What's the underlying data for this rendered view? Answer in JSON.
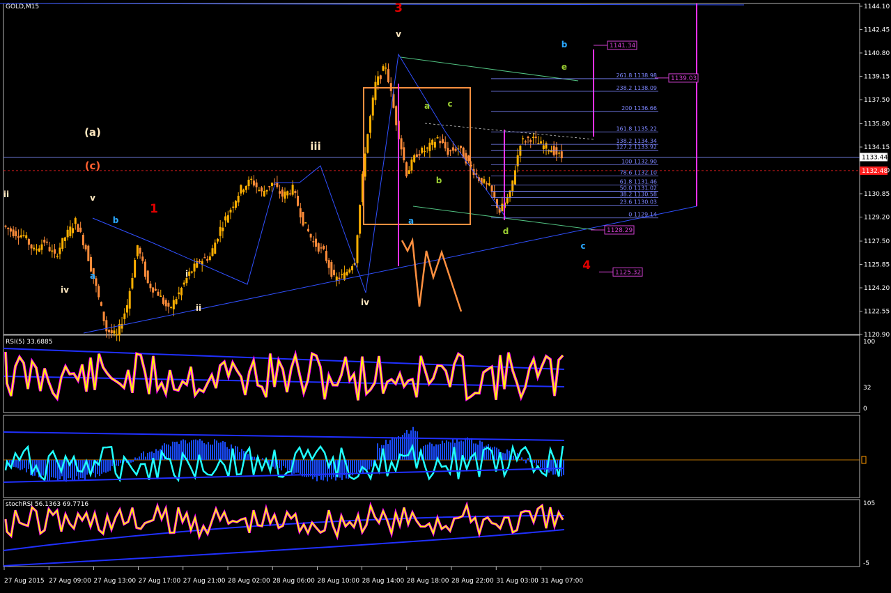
{
  "window": {
    "title": "GOLD,M15",
    "current_price_label": "1133.44",
    "bid_label": "1132.48"
  },
  "colors": {
    "background": "#000000",
    "grid": "#ffffff",
    "bull_candle": "#ffb000",
    "bear_candle": "#ff8c3a",
    "trendline": "#3050ff",
    "fib": "#7d86ff",
    "target_box": "#d040d0",
    "wave_red": "#e00000",
    "wave_cyan": "#2aa8ff",
    "wave_green": "#9acd32",
    "wave_cream": "#ffe8c0",
    "projection": "#ff9040",
    "rsi_line": "#ffff00",
    "rsi_highlight": "#ff00ff"
  },
  "price_axis": {
    "ticks": [
      "1144.10",
      "1142.45",
      "1140.80",
      "1139.15",
      "1137.50",
      "1135.80",
      "1134.15",
      "1132.50",
      "1130.85",
      "1129.20",
      "1127.50",
      "1125.85",
      "1124.20",
      "1122.55",
      "1120.90"
    ]
  },
  "time_axis": {
    "ticks": [
      "27 Aug 2015",
      "27 Aug 09:00",
      "27 Aug 13:00",
      "27 Aug 17:00",
      "27 Aug 21:00",
      "28 Aug 02:00",
      "28 Aug 06:00",
      "28 Aug 10:00",
      "28 Aug 14:00",
      "28 Aug 18:00",
      "28 Aug 22:00",
      "31 Aug 03:00",
      "31 Aug 07:00"
    ]
  },
  "fib_levels": [
    {
      "label": "261.8 1138.98",
      "price": 1138.98
    },
    {
      "label": "238.2 1138.09",
      "price": 1138.09
    },
    {
      "label": "200 1136.66",
      "price": 1136.66
    },
    {
      "label": "161.8 1135.22",
      "price": 1135.22
    },
    {
      "label": "138.2 1134.34",
      "price": 1134.34
    },
    {
      "label": "127.2 1133.92",
      "price": 1133.92
    },
    {
      "label": "100 1132.90",
      "price": 1132.9
    },
    {
      "label": "78.6 1132.10",
      "price": 1132.1
    },
    {
      "label": "61.8 1131.46",
      "price": 1131.46
    },
    {
      "label": "50.0 1131.02",
      "price": 1131.02
    },
    {
      "label": "38.2 1130.58",
      "price": 1130.58
    },
    {
      "label": "23.6 1130.03",
      "price": 1130.03
    },
    {
      "label": "0 1129.14",
      "price": 1129.14
    }
  ],
  "price_targets": [
    {
      "label": "1141.34",
      "price": 1141.34
    },
    {
      "label": "1139.03",
      "price": 1139.03
    },
    {
      "label": "1128.29",
      "price": 1128.29
    },
    {
      "label": "1125.32",
      "price": 1125.32
    }
  ],
  "wave_labels": [
    {
      "text": "3",
      "color": "red",
      "x": 572,
      "y": 12
    },
    {
      "text": "v",
      "color": "cream",
      "x": 572,
      "y": 48
    },
    {
      "text": "b",
      "color": "cyan",
      "x": 810,
      "y": 63
    },
    {
      "text": "e",
      "color": "green",
      "x": 810,
      "y": 95
    },
    {
      "text": "(a)",
      "color": "cream",
      "x": 133,
      "y": 190
    },
    {
      "text": "(c)",
      "color": "orange",
      "x": 133,
      "y": 238
    },
    {
      "text": "iii",
      "color": "cream",
      "x": 453,
      "y": 210
    },
    {
      "text": "ii",
      "color": "cream",
      "x": 9,
      "y": 278
    },
    {
      "text": "v",
      "color": "cream",
      "x": 133,
      "y": 283
    },
    {
      "text": "1",
      "color": "red",
      "x": 221,
      "y": 300
    },
    {
      "text": "b",
      "color": "cyan",
      "x": 166,
      "y": 315
    },
    {
      "text": "a",
      "color": "green",
      "x": 613,
      "y": 151
    },
    {
      "text": "c",
      "color": "green",
      "x": 646,
      "y": 148
    },
    {
      "text": "b",
      "color": "green",
      "x": 630,
      "y": 258
    },
    {
      "text": "a",
      "color": "cyan",
      "x": 590,
      "y": 316
    },
    {
      "text": "d",
      "color": "green",
      "x": 726,
      "y": 331
    },
    {
      "text": "c",
      "color": "cyan",
      "x": 837,
      "y": 352
    },
    {
      "text": "4",
      "color": "red",
      "x": 842,
      "y": 381
    },
    {
      "text": "i",
      "color": "cream",
      "x": 268,
      "y": 392
    },
    {
      "text": "a",
      "color": "cyan",
      "x": 133,
      "y": 395
    },
    {
      "text": "iv",
      "color": "cream",
      "x": 93,
      "y": 415
    },
    {
      "text": "ii",
      "color": "cream",
      "x": 285,
      "y": 441
    },
    {
      "text": "iv",
      "color": "cream",
      "x": 524,
      "y": 433
    }
  ],
  "rsi": {
    "title": "RSI(5) 33.6885",
    "scale": [
      "100",
      "32",
      "0"
    ]
  },
  "macd": {
    "title": ""
  },
  "stoch": {
    "title": "stochRSI 56.1363 69.7716",
    "scale": [
      "105",
      "-5"
    ]
  },
  "chart_data": {
    "type": "candlestick",
    "title": "GOLD,M15",
    "ylim": [
      1120.9,
      1144.1
    ],
    "x": [
      "27 Aug 2015",
      "27 Aug 09:00",
      "27 Aug 13:00",
      "27 Aug 17:00",
      "27 Aug 21:00",
      "28 Aug 02:00",
      "28 Aug 06:00",
      "28 Aug 10:00",
      "28 Aug 14:00",
      "28 Aug 18:00",
      "28 Aug 22:00",
      "31 Aug 03:00",
      "31 Aug 07:00"
    ],
    "close_path": [
      1128.6,
      1128.1,
      1127.9,
      1126.8,
      1127.5,
      1126.4,
      1127.8,
      1128.9,
      1127.0,
      1124.2,
      1121.2,
      1120.8,
      1123.0,
      1127.2,
      1124.5,
      1123.8,
      1122.6,
      1123.8,
      1125.2,
      1126.1,
      1126.4,
      1128.4,
      1129.8,
      1131.2,
      1131.8,
      1130.9,
      1131.6,
      1130.7,
      1131.2,
      1128.9,
      1127.4,
      1126.7,
      1124.8,
      1125.1,
      1126.2,
      1133.9,
      1138.6,
      1139.9,
      1135.9,
      1132.3,
      1133.7,
      1134.0,
      1134.8,
      1133.8,
      1134.1,
      1133.0,
      1131.9,
      1131.3,
      1129.6,
      1130.8,
      1134.5,
      1134.8,
      1134.3,
      1134.0,
      1133.4
    ],
    "series": [
      {
        "name": "RSI(5)",
        "last": 33.6885
      },
      {
        "name": "stochRSI",
        "values": [
          56.1363,
          69.7716
        ]
      }
    ]
  }
}
